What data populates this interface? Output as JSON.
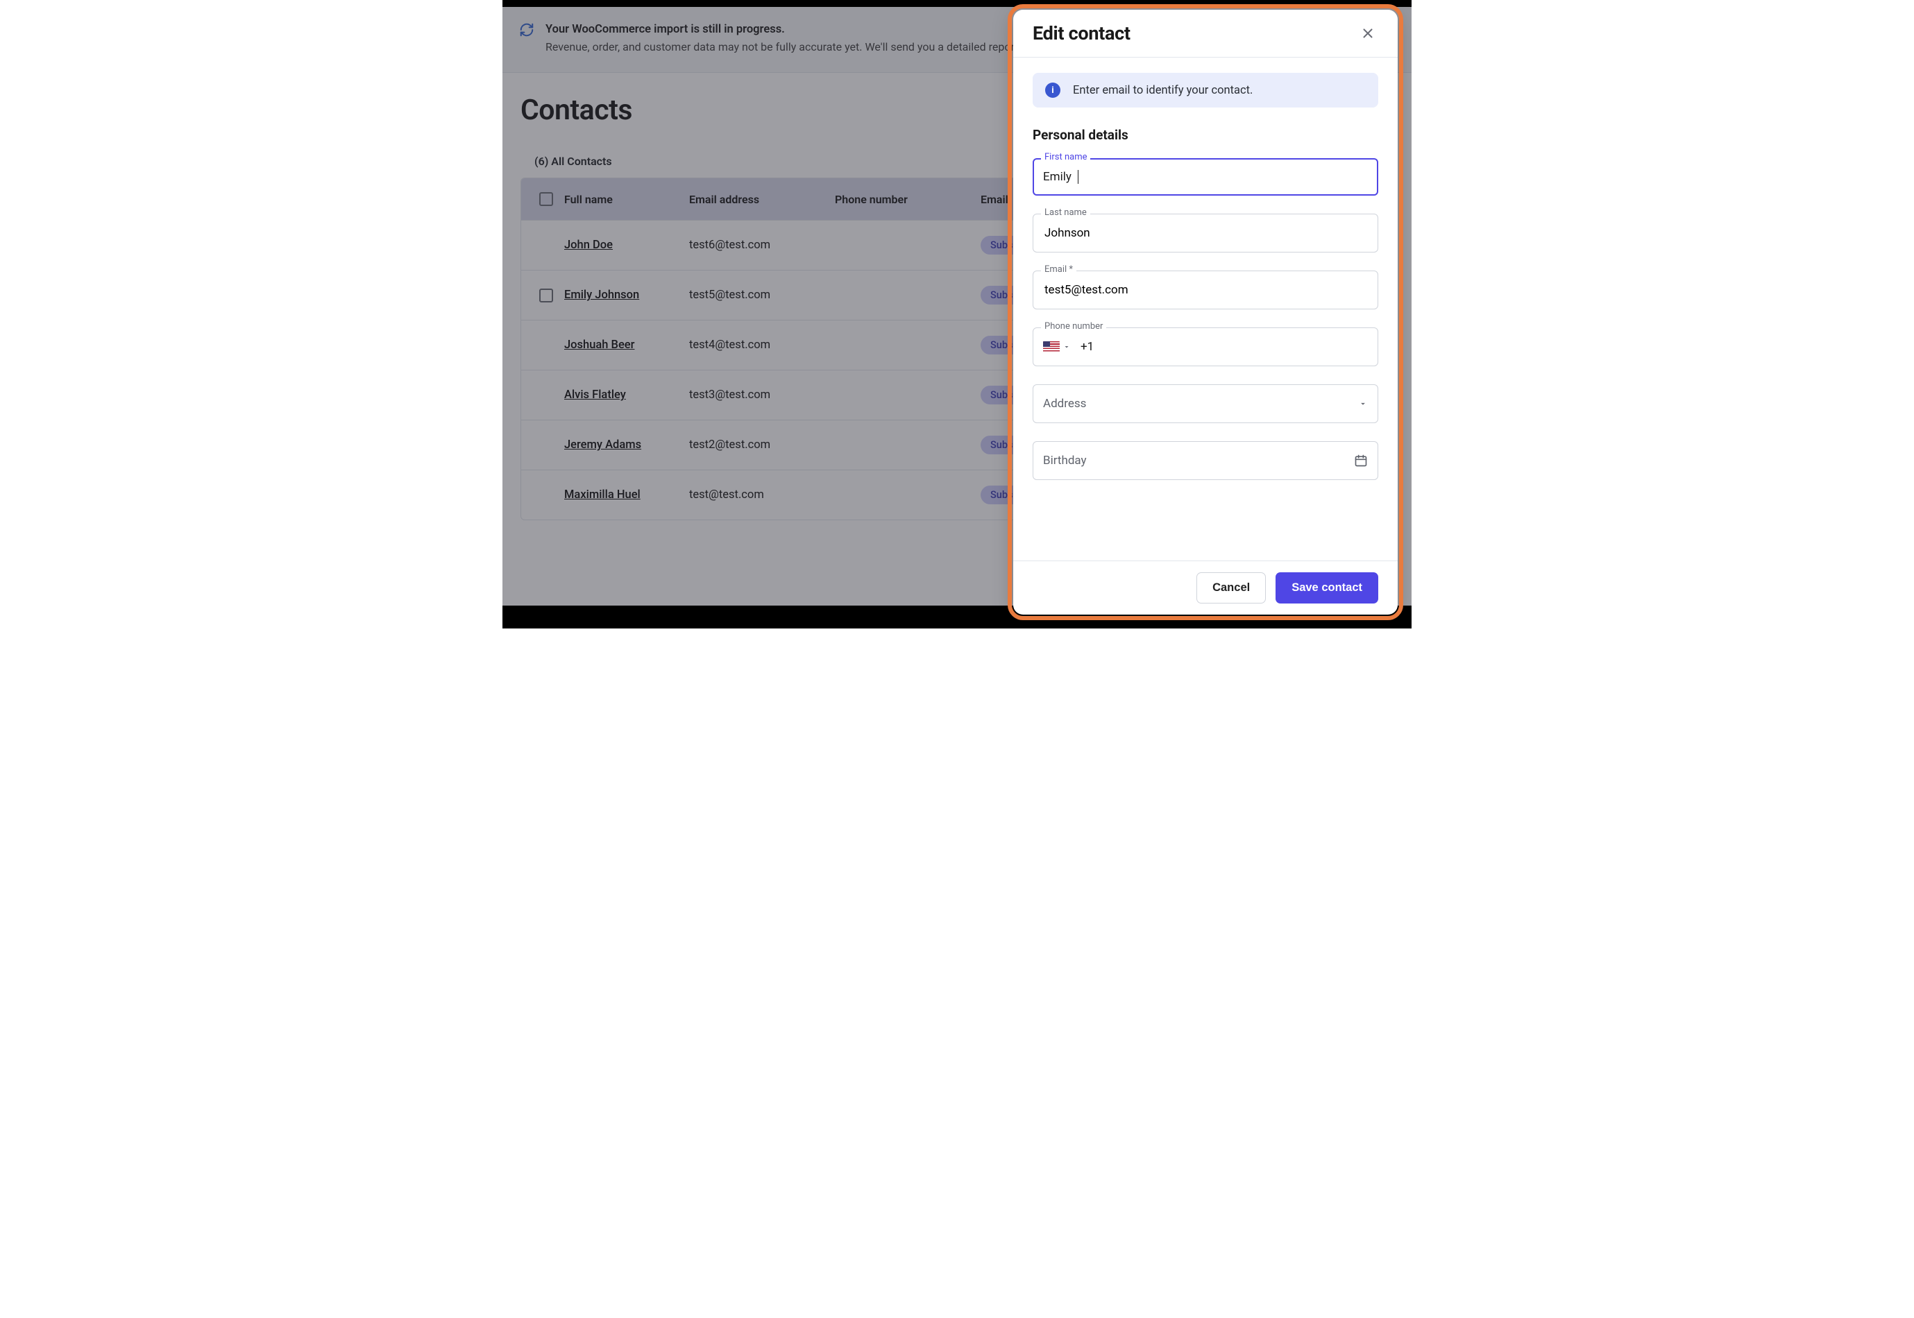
{
  "banner": {
    "title": "Your WooCommerce import is still in progress.",
    "subtitle": "Revenue, order, and customer data may not be fully accurate yet. We'll send you a detailed report by email once it's done."
  },
  "page": {
    "title": "Contacts",
    "tab_label": "(6) All Contacts"
  },
  "table": {
    "columns": {
      "full_name": "Full name",
      "email": "Email address",
      "phone": "Phone number",
      "status_header": "Email"
    },
    "rows": [
      {
        "name": "John Doe",
        "email": "test6@test.com",
        "phone": "",
        "status": "Subscribed",
        "checked": false
      },
      {
        "name": "Emily Johnson",
        "email": "test5@test.com",
        "phone": "",
        "status": "Subscribed",
        "checked": false
      },
      {
        "name": "Joshuah Beer",
        "email": "test4@test.com",
        "phone": "",
        "status": "Subscribed",
        "checked": false
      },
      {
        "name": "Alvis Flatley",
        "email": "test3@test.com",
        "phone": "",
        "status": "Subscribed",
        "checked": false
      },
      {
        "name": "Jeremy Adams",
        "email": "test2@test.com",
        "phone": "",
        "status": "Subscribed",
        "checked": false
      },
      {
        "name": "Maximilla Huel",
        "email": "test@test.com",
        "phone": "",
        "status": "Subscribed",
        "checked": false
      }
    ],
    "row_checkbox_indices": [
      1
    ]
  },
  "drawer": {
    "title": "Edit contact",
    "info_message": "Enter email to identify your contact.",
    "section_title": "Personal details",
    "labels": {
      "first_name": "First name",
      "last_name": "Last name",
      "email": "Email *",
      "phone": "Phone number",
      "address": "Address",
      "birthday": "Birthday"
    },
    "values": {
      "first_name": "Emily",
      "last_name": "Johnson",
      "email": "test5@test.com",
      "phone_prefix": "+1",
      "phone": ""
    },
    "buttons": {
      "cancel": "Cancel",
      "save": "Save contact"
    }
  }
}
